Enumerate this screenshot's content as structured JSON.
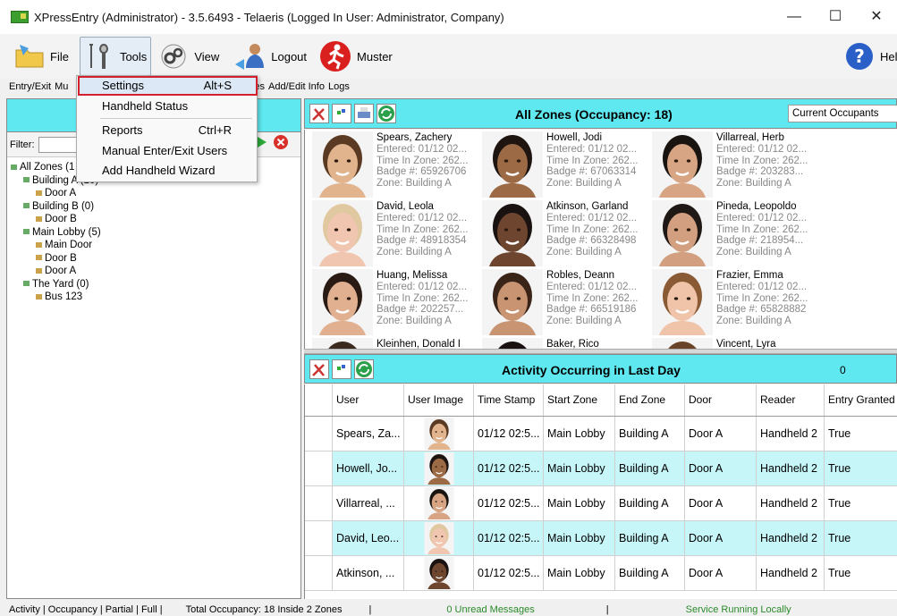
{
  "window": {
    "title": "XPressEntry (Administrator)  - 3.5.6493 - Telaeris (Logged In User: Administrator, Company)",
    "min": "—",
    "max": "☐",
    "close": "✕"
  },
  "toolbar": {
    "file": "File",
    "tools": "Tools",
    "view": "View",
    "logout": "Logout",
    "muster": "Muster",
    "help": "Hel"
  },
  "tabs": [
    "Entry/Exit",
    "Mu",
    "es",
    "Add/Edit Info",
    "Logs"
  ],
  "menu": {
    "settings": "Settings",
    "settings_key": "Alt+S",
    "handheld_status": "Handheld Status",
    "reports": "Reports",
    "reports_key": "Ctrl+R",
    "manual": "Manual Enter/Exit Users",
    "wizard": "Add Handheld Wizard"
  },
  "left": {
    "filter_label": "Filter:",
    "tree": [
      {
        "label": "All Zones (1",
        "depth": 0,
        "type": "zone"
      },
      {
        "label": "Building A (10)",
        "depth": 1,
        "type": "zone"
      },
      {
        "label": "Door A",
        "depth": 2,
        "type": "door"
      },
      {
        "label": "Building B (0)",
        "depth": 1,
        "type": "zone"
      },
      {
        "label": "Door B",
        "depth": 2,
        "type": "door"
      },
      {
        "label": "Main Lobby (5)",
        "depth": 1,
        "type": "zone"
      },
      {
        "label": "Main Door",
        "depth": 2,
        "type": "door"
      },
      {
        "label": "Door B",
        "depth": 2,
        "type": "door"
      },
      {
        "label": "Door A",
        "depth": 2,
        "type": "door"
      },
      {
        "label": "The Yard (0)",
        "depth": 1,
        "type": "zone"
      },
      {
        "label": "Bus 123",
        "depth": 2,
        "type": "door"
      }
    ]
  },
  "zones": {
    "title": "All Zones (Occupancy: 18)",
    "dropdown": "Current Occupants",
    "cards": [
      {
        "name": "Spears, Zachery",
        "entered": "Entered: 01/12 02...",
        "time": "Time In Zone: 262...",
        "badge": "Badge #: 65926706",
        "zone": "Zone: Building A",
        "skin": "#e2b48e",
        "hair": "#5a3a22"
      },
      {
        "name": "Howell, Jodi",
        "entered": "Entered: 01/12 02...",
        "time": "Time In Zone: 262...",
        "badge": "Badge #: 67063314",
        "zone": "Zone: Building A",
        "skin": "#9c6a45",
        "hair": "#1e1410"
      },
      {
        "name": "Villarreal, Herb",
        "entered": "Entered: 01/12 02...",
        "time": "Time In Zone: 262...",
        "badge": "Badge #: 203283...",
        "zone": "Zone: Building A",
        "skin": "#d7a584",
        "hair": "#1a1410"
      },
      {
        "name": "David, Leola",
        "entered": "Entered: 01/12 02...",
        "time": "Time In Zone: 262...",
        "badge": "Badge #: 48918354",
        "zone": "Zone: Building A",
        "skin": "#f0c6b0",
        "hair": "#e0c8a0"
      },
      {
        "name": "Atkinson, Garland",
        "entered": "Entered: 01/12 02...",
        "time": "Time In Zone: 262...",
        "badge": "Badge #: 66328498",
        "zone": "Zone: Building A",
        "skin": "#6e4630",
        "hair": "#1a1210"
      },
      {
        "name": "Pineda, Leopoldo",
        "entered": "Entered: 01/12 02...",
        "time": "Time In Zone: 262...",
        "badge": "Badge #: 218954...",
        "zone": "Zone: Building A",
        "skin": "#d2a080",
        "hair": "#201814"
      },
      {
        "name": "Huang, Melissa",
        "entered": "Entered: 01/12 02...",
        "time": "Time In Zone: 262...",
        "badge": "Badge #: 202257...",
        "zone": "Zone: Building A",
        "skin": "#e0b090",
        "hair": "#2a1a14"
      },
      {
        "name": "Robles, Deann",
        "entered": "Entered: 01/12 02...",
        "time": "Time In Zone: 262...",
        "badge": "Badge #: 66519186",
        "zone": "Zone: Building A",
        "skin": "#c89472",
        "hair": "#3a2418"
      },
      {
        "name": "Frazier, Emma",
        "entered": "Entered: 01/12 02...",
        "time": "Time In Zone: 262...",
        "badge": "Badge #: 65828882",
        "zone": "Zone: Building A",
        "skin": "#f0c4a8",
        "hair": "#8a5a34"
      },
      {
        "name": "Kleinhen, Donald I",
        "entered": "",
        "time": "",
        "badge": "",
        "zone": "",
        "skin": "#d8a888",
        "hair": "#3a2a20"
      },
      {
        "name": "Baker, Rico",
        "entered": "",
        "time": "",
        "badge": "",
        "zone": "",
        "skin": "#8a5a3c",
        "hair": "#1a1210"
      },
      {
        "name": "Vincent, Lyra",
        "entered": "",
        "time": "",
        "badge": "",
        "zone": "",
        "skin": "#e8c0a0",
        "hair": "#6a4428"
      }
    ]
  },
  "activity": {
    "title": "Activity Occurring in Last Day",
    "count": "0",
    "headers": [
      "User",
      "User Image",
      "Time Stamp",
      "Start Zone",
      "End Zone",
      "Door",
      "Reader",
      "Entry Granted"
    ],
    "rows": [
      {
        "user": "Spears, Za...",
        "time": "01/12 02:5...",
        "start": "Main Lobby",
        "end": "Building A",
        "door": "Door A",
        "reader": "Handheld 2",
        "granted": "True",
        "skin": "#e2b48e",
        "hair": "#5a3a22"
      },
      {
        "user": "Howell, Jo...",
        "time": "01/12 02:5...",
        "start": "Main Lobby",
        "end": "Building A",
        "door": "Door A",
        "reader": "Handheld 2",
        "granted": "True",
        "skin": "#9c6a45",
        "hair": "#1e1410"
      },
      {
        "user": "Villarreal, ...",
        "time": "01/12 02:5...",
        "start": "Main Lobby",
        "end": "Building A",
        "door": "Door A",
        "reader": "Handheld 2",
        "granted": "True",
        "skin": "#d7a584",
        "hair": "#1a1410"
      },
      {
        "user": "David, Leo...",
        "time": "01/12 02:5...",
        "start": "Main Lobby",
        "end": "Building A",
        "door": "Door A",
        "reader": "Handheld 2",
        "granted": "True",
        "skin": "#f0c6b0",
        "hair": "#e0c8a0"
      },
      {
        "user": "Atkinson, ...",
        "time": "01/12 02:5...",
        "start": "Main Lobby",
        "end": "Building A",
        "door": "Door A",
        "reader": "Handheld 2",
        "granted": "True",
        "skin": "#6e4630",
        "hair": "#1a1210"
      }
    ]
  },
  "status": {
    "tabs": "Activity | Occupancy | Partial | Full |",
    "occupancy": "Total Occupancy: 18 Inside 2 Zones",
    "messages": "0 Unread Messages",
    "service": "Service Running Locally",
    "green": "#2a8a2a"
  }
}
